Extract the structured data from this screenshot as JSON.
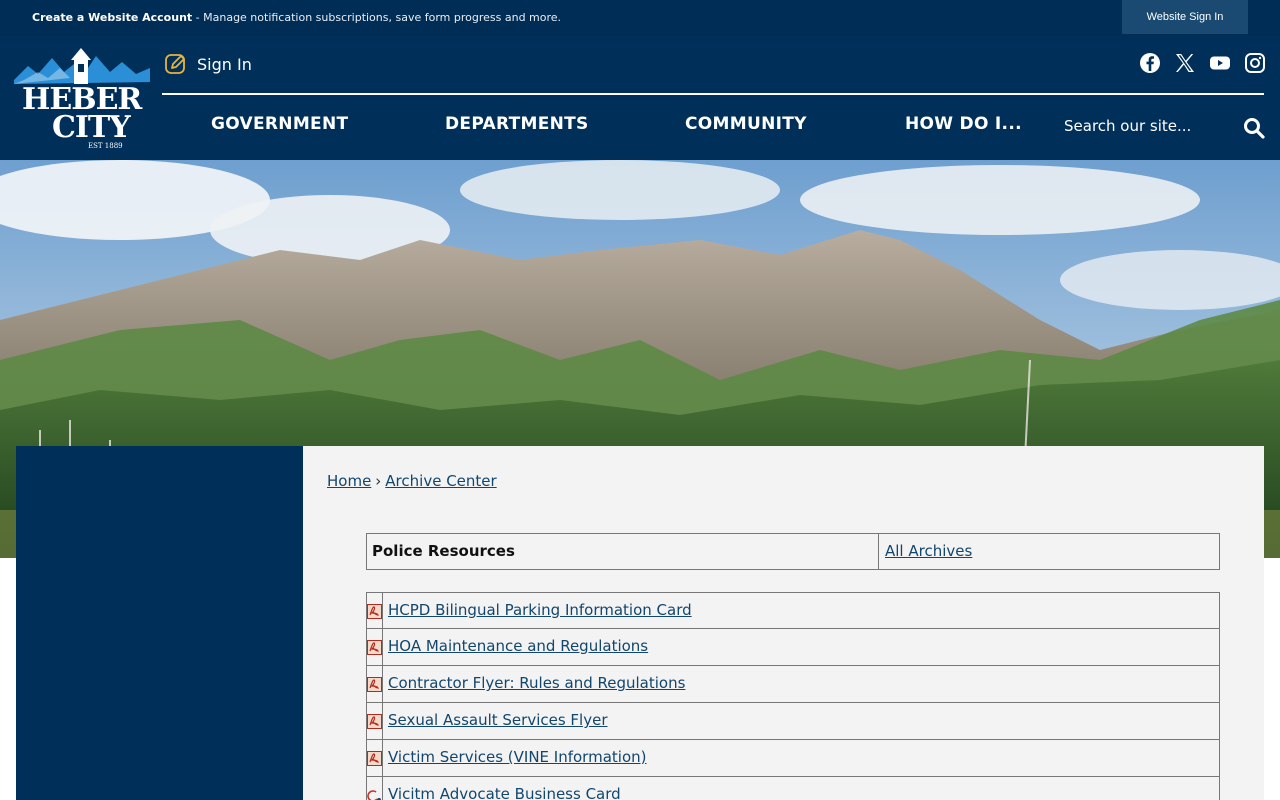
{
  "topbar": {
    "create_account": "Create a Website Account",
    "create_desc": " - Manage notification subscriptions, save form progress and more.",
    "website_sign_in": "Website Sign In"
  },
  "header": {
    "logo_text_1": "HEBER",
    "logo_text_2": "CITY",
    "logo_est": "EST 1889",
    "sign_in": "Sign In",
    "social_icons": [
      "facebook-icon",
      "x-icon",
      "youtube-icon",
      "instagram-icon"
    ],
    "nav": [
      "GOVERNMENT",
      "DEPARTMENTS",
      "COMMUNITY",
      "HOW DO I..."
    ],
    "search_placeholder": "Search our site..."
  },
  "breadcrumb": {
    "home": "Home",
    "separator": "›",
    "current": "Archive Center"
  },
  "archive": {
    "category": "Police Resources",
    "all_archives": "All Archives",
    "documents": [
      {
        "title": "HCPD Bilingual Parking Information Card",
        "icon": "pdf-icon"
      },
      {
        "title": "HOA Maintenance and Regulations",
        "icon": "pdf-icon"
      },
      {
        "title": "Contractor Flyer: Rules and Regulations",
        "icon": "pdf-icon"
      },
      {
        "title": "Sexual Assault Services Flyer",
        "icon": "pdf-icon"
      },
      {
        "title": "Victim Services (VINE Information)",
        "icon": "pdf-icon"
      },
      {
        "title": "Vicitm Advocate Business Card",
        "icon": "image-icon"
      }
    ]
  },
  "colors": {
    "header_bg": "#003059",
    "topbar_bg": "#002d55",
    "link": "#12466d",
    "content_bg": "#f3f3f3"
  }
}
